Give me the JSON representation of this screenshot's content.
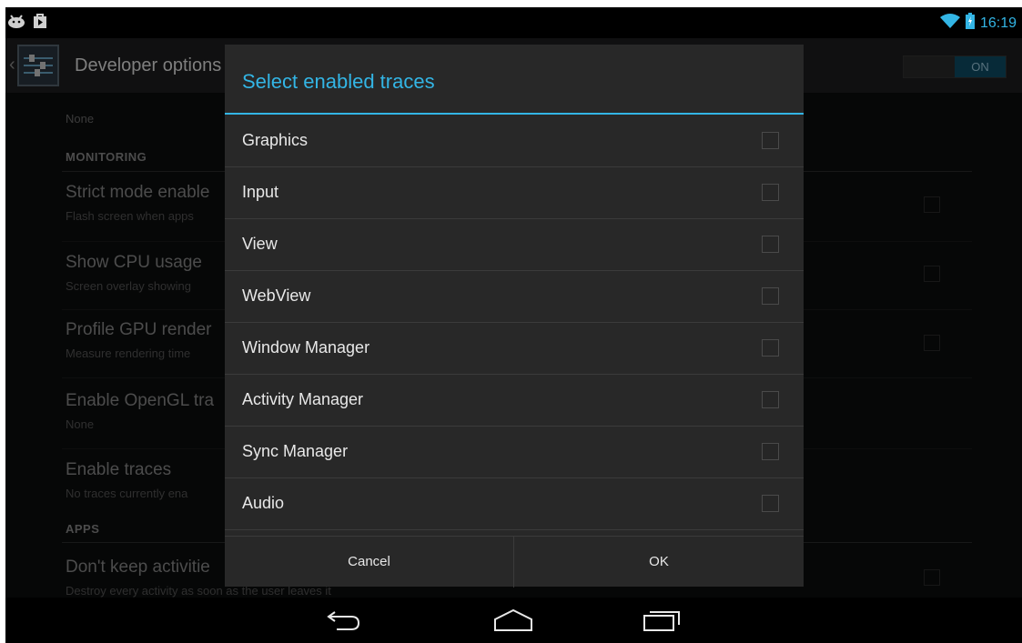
{
  "status_bar": {
    "time": "16:19",
    "icons": [
      "android-debug-icon",
      "play-store-notification-icon",
      "wifi-icon",
      "battery-charging-icon"
    ],
    "accent": "#33b5e5"
  },
  "action_bar": {
    "title": "Developer options",
    "switch_label": "ON"
  },
  "background_list": {
    "top_summary": "None",
    "section_monitoring": "MONITORING",
    "items": [
      {
        "title": "Strict mode enable",
        "summary": "Flash screen when apps"
      },
      {
        "title": "Show CPU usage",
        "summary": "Screen overlay showing"
      },
      {
        "title": "Profile GPU render",
        "summary": "Measure rendering time"
      },
      {
        "title": "Enable OpenGL tra",
        "summary": "None"
      },
      {
        "title": "Enable traces",
        "summary": "No traces currently ena"
      }
    ],
    "section_apps": "APPS",
    "apps_item": {
      "title": "Don't keep activitie",
      "summary": "Destroy every activity as soon as the user leaves it"
    }
  },
  "dialog": {
    "title": "Select enabled traces",
    "options": [
      {
        "label": "Graphics",
        "checked": false
      },
      {
        "label": "Input",
        "checked": false
      },
      {
        "label": "View",
        "checked": false
      },
      {
        "label": "WebView",
        "checked": false
      },
      {
        "label": "Window Manager",
        "checked": false
      },
      {
        "label": "Activity Manager",
        "checked": false
      },
      {
        "label": "Sync Manager",
        "checked": false
      },
      {
        "label": "Audio",
        "checked": false
      }
    ],
    "cancel_label": "Cancel",
    "ok_label": "OK"
  },
  "nav_bar": {
    "buttons": [
      "back-icon",
      "home-icon",
      "recent-apps-icon"
    ]
  }
}
